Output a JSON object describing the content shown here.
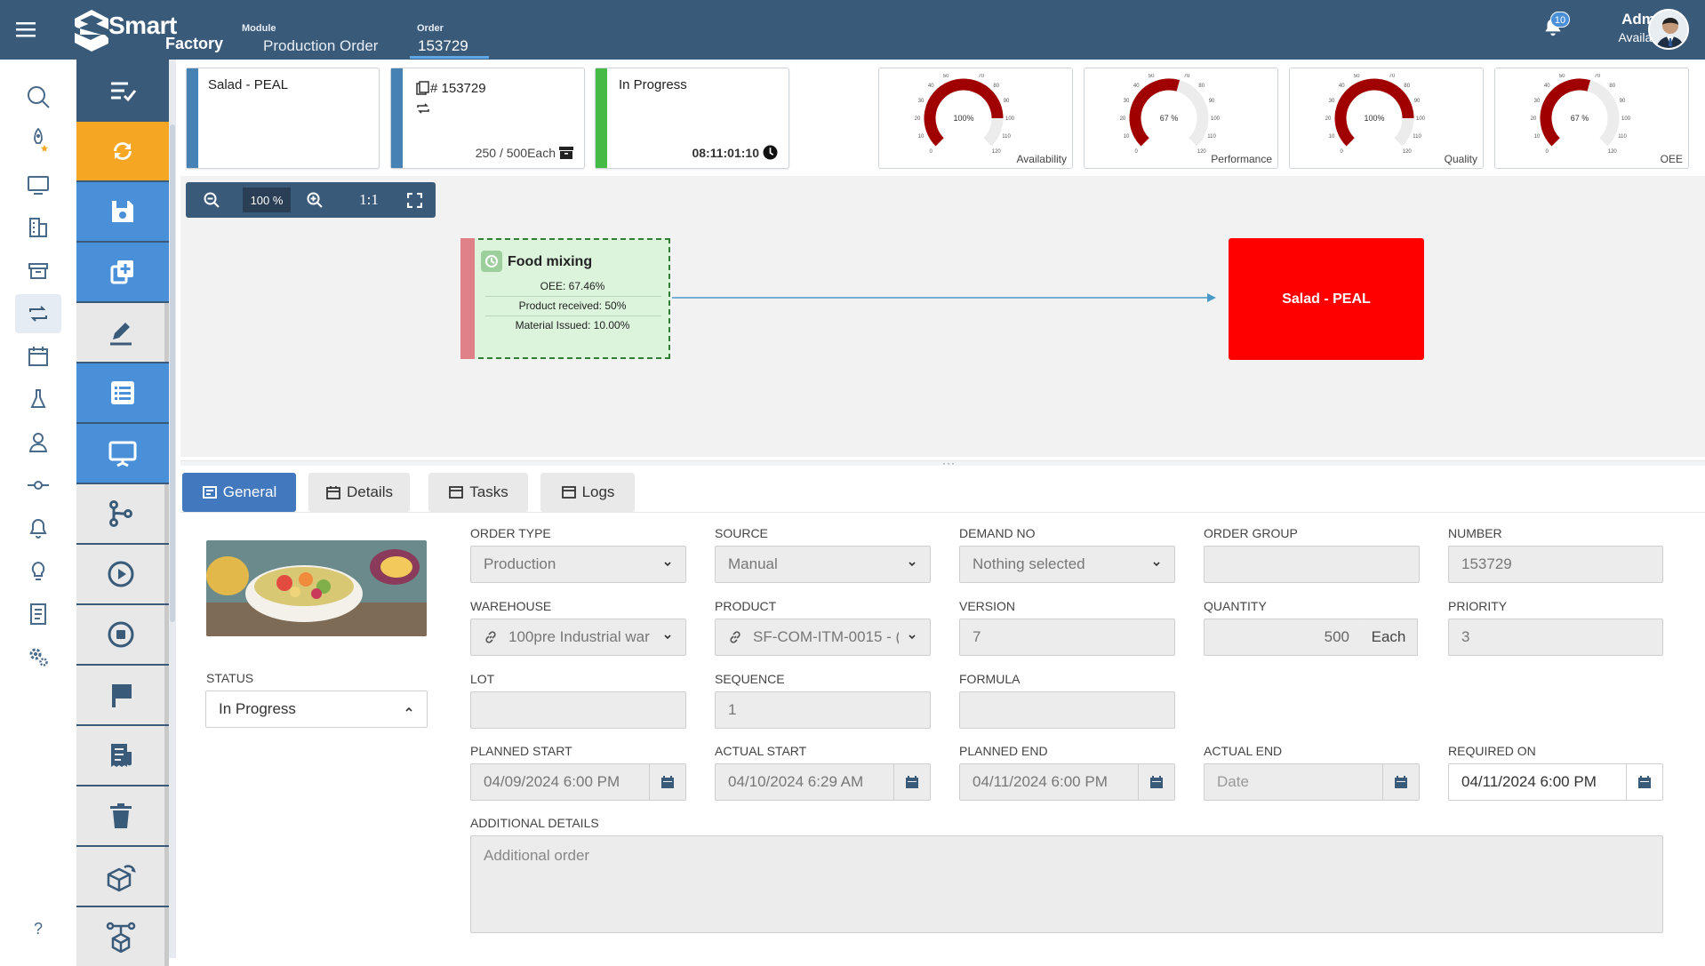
{
  "header": {
    "module_label": "Module",
    "module_value": "Production Order",
    "order_label": "Order",
    "order_value": "153729",
    "notification_count": "10",
    "user_name": "Admin",
    "user_status": "Available",
    "logo_line1": "Smart",
    "logo_line2": "Factory"
  },
  "left_nav": [
    "search-icon",
    "rocket-star-icon",
    "monitor-icon",
    "buildings-icon",
    "archive-box-icon",
    "repeat-icon",
    "calendar-icon",
    "flask-icon",
    "users-icon",
    "commit-icon",
    "bell-icon",
    "bulb-icon",
    "report-icon",
    "settings-icon",
    "help-icon"
  ],
  "left_nav_help": "?",
  "toolbar": [
    "list-check-icon",
    "sync-icon",
    "save-icon",
    "copy-add-icon",
    "edit-icon",
    "list-icon",
    "presentation-icon",
    "branch-icon",
    "play-icon",
    "stop-icon",
    "flag-icon",
    "receipt-icon",
    "trash-icon",
    "box-return-icon",
    "hierarchy-box-icon"
  ],
  "cards": {
    "product": {
      "title": "Salad - PEAL",
      "color": "#4682b4"
    },
    "order": {
      "title": "# 153729",
      "progress_text": "250 / 500Each",
      "progress": 0.5,
      "color": "#4682b4"
    },
    "status": {
      "title": "In Progress",
      "timer": "08:11:01:10",
      "color": "#44bb44"
    }
  },
  "gauges": [
    {
      "label": "Availability",
      "value_text": "100%",
      "value": 100
    },
    {
      "label": "Performance",
      "value_text": "67 %",
      "value": 67
    },
    {
      "label": "Quality",
      "value_text": "100%",
      "value": 100
    },
    {
      "label": "OEE",
      "value_text": "67 %",
      "value": 67
    }
  ],
  "zoom": {
    "level": "100 %",
    "ratio": "1:1"
  },
  "diagram": {
    "node1": {
      "title": "Food mixing",
      "lines": [
        "OEE: 67.46%",
        "Product received: 50%",
        "Material Issued: 10.00%"
      ]
    },
    "node2": {
      "title": "Salad - PEAL"
    }
  },
  "tabs": [
    {
      "label": "General",
      "active": true
    },
    {
      "label": "Details",
      "active": false
    },
    {
      "label": "Tasks",
      "active": false
    },
    {
      "label": "Logs",
      "active": false
    }
  ],
  "form": {
    "status": {
      "label": "STATUS",
      "value": "In Progress"
    },
    "order_type": {
      "label": "ORDER TYPE",
      "value": "Production"
    },
    "source": {
      "label": "SOURCE",
      "value": "Manual"
    },
    "demand_no": {
      "label": "DEMAND NO",
      "value": "Nothing selected"
    },
    "order_group": {
      "label": "ORDER GROUP",
      "value": ""
    },
    "number": {
      "label": "NUMBER",
      "value": "153729"
    },
    "warehouse": {
      "label": "WAREHOUSE",
      "value": "100pre Industrial war"
    },
    "product": {
      "label": "PRODUCT",
      "value": "SF-COM-ITM-0015 - ("
    },
    "version": {
      "label": "VERSION",
      "value": "7"
    },
    "quantity": {
      "label": "QUANTITY",
      "value": "500",
      "unit": "Each"
    },
    "priority": {
      "label": "PRIORITY",
      "value": "3"
    },
    "lot": {
      "label": "LOT",
      "value": ""
    },
    "sequence": {
      "label": "SEQUENCE",
      "value": "1"
    },
    "formula": {
      "label": "FORMULA",
      "value": ""
    },
    "planned_start": {
      "label": "PLANNED START",
      "value": "04/09/2024 6:00 PM"
    },
    "actual_start": {
      "label": "ACTUAL START",
      "value": "04/10/2024 6:29 AM"
    },
    "planned_end": {
      "label": "PLANNED END",
      "value": "04/11/2024 6:00 PM"
    },
    "actual_end": {
      "label": "ACTUAL END",
      "value": "",
      "placeholder": "Date"
    },
    "required_on": {
      "label": "REQUIRED ON",
      "value": "04/11/2024 6:00 PM"
    },
    "additional_details": {
      "label": "ADDITIONAL DETAILS",
      "placeholder": "Additional order"
    }
  }
}
